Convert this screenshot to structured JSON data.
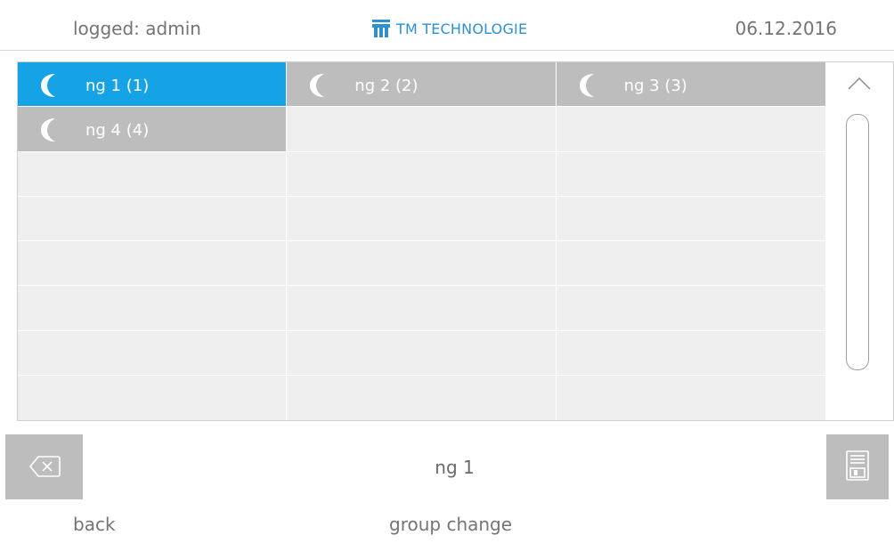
{
  "header": {
    "logged_text": "logged: admin",
    "brand_text": "TM TECHNOLOGIE",
    "date": "06.12.2016",
    "brand_color": "#2f8fcf"
  },
  "grid": {
    "icon": "moon-icon",
    "selected_color": "#16a3e6",
    "filled_color": "#bdbdbd",
    "empty_color": "#efefef",
    "items": [
      {
        "label": "ng 1 (1)",
        "state": "selected"
      },
      {
        "label": "ng 2 (2)",
        "state": "filled"
      },
      {
        "label": "ng 3 (3)",
        "state": "filled"
      },
      {
        "label": "ng 4 (4)",
        "state": "filled"
      }
    ]
  },
  "scrollbar": {
    "up_icon": "chevron-up-icon"
  },
  "input": {
    "value": "ng 1",
    "clear_icon": "backspace-icon",
    "save_icon": "save-icon"
  },
  "footer": {
    "back_label": "back",
    "group_change_label": "group change"
  }
}
